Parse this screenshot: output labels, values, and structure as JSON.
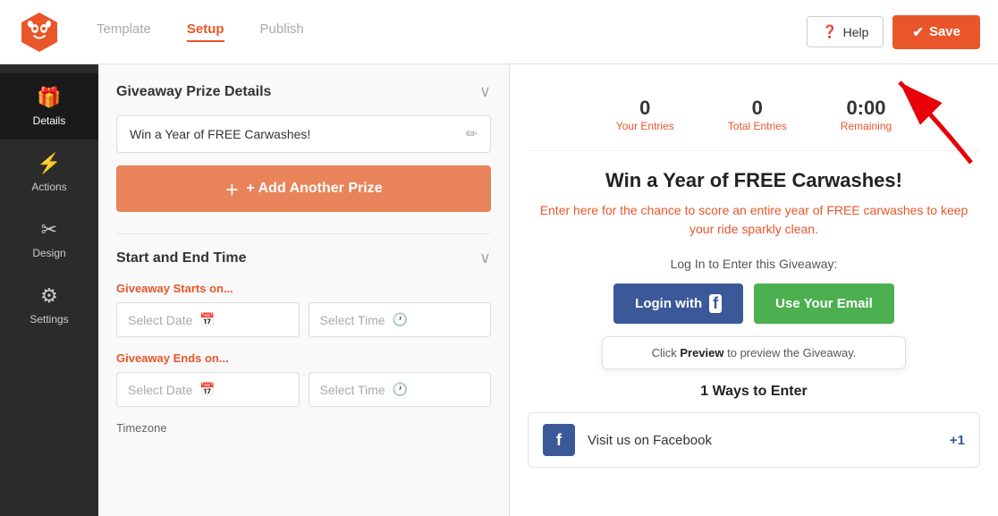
{
  "topNav": {
    "tabs": [
      {
        "label": "Template",
        "active": false
      },
      {
        "label": "Setup",
        "active": true
      },
      {
        "label": "Publish",
        "active": false
      }
    ],
    "helpLabel": "Help",
    "saveLabel": "Save"
  },
  "sidebar": {
    "items": [
      {
        "label": "Details",
        "icon": "🎁",
        "active": true
      },
      {
        "label": "Actions",
        "icon": "⚡",
        "active": false
      },
      {
        "label": "Design",
        "icon": "✂",
        "active": false
      },
      {
        "label": "Settings",
        "icon": "⚙",
        "active": false
      }
    ]
  },
  "prizeSection": {
    "title": "Giveaway Prize Details",
    "prizeName": "Win a Year of FREE Carwashes!",
    "addPrizeLabel": "+ Add Another Prize"
  },
  "timeSection": {
    "title": "Start and End Time",
    "startsLabel": "Giveaway Starts on...",
    "endsLabel": "Giveaway Ends on...",
    "selectDatePlaceholder": "Select Date",
    "selectTimePlaceholder": "Select Time",
    "timezoneLabel": "Timezone"
  },
  "preview": {
    "stats": [
      {
        "number": "0",
        "label": "Your Entries"
      },
      {
        "number": "0",
        "label": "Total Entries"
      },
      {
        "number": "0:00",
        "label": "Remaining"
      }
    ],
    "title": "Win a Year of FREE Carwashes!",
    "description": "Enter here for the chance to score ",
    "descriptionHighlight": "an entire year of FREE carwashes",
    "descriptionEnd": " to keep your ride sparkly clean.",
    "loginPrompt": "Log In to Enter this Giveaway:",
    "loginWithFbLabel": "Login with",
    "useEmailLabel": "Use Your Email",
    "tooltipText": "Click ",
    "tooltipBold": "Preview",
    "tooltipEnd": " to preview the Giveaway.",
    "waysToEnter": "1 Ways to Enter",
    "entryMethod": "Visit us on Facebook",
    "entryPlus": "+1"
  }
}
